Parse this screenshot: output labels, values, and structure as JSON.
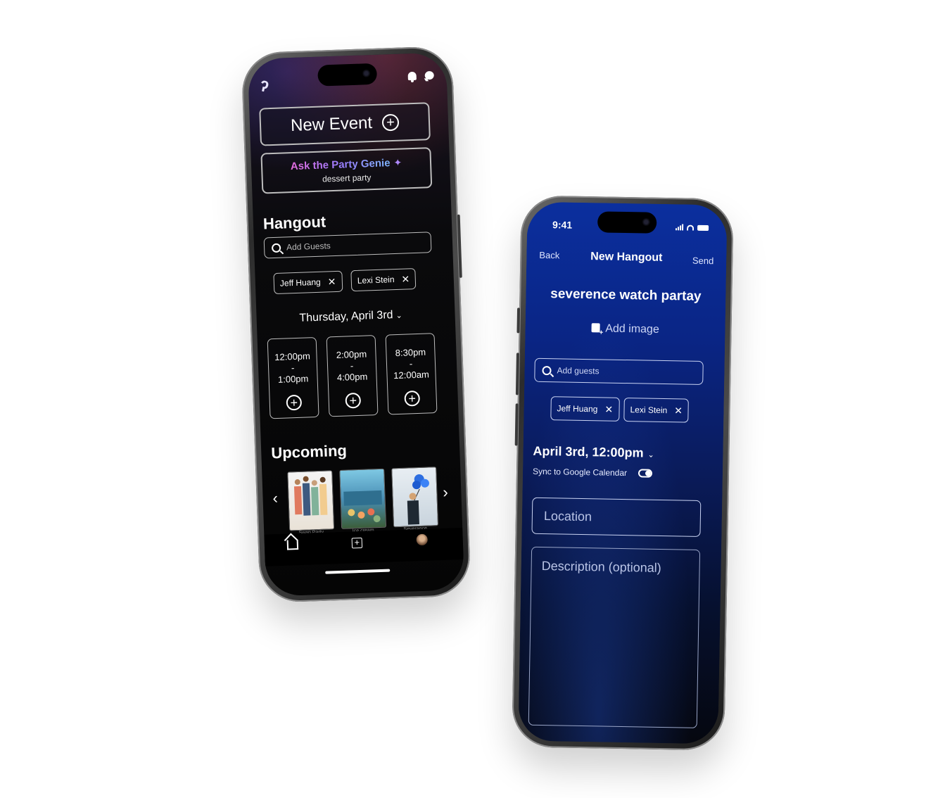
{
  "phone1": {
    "new_event_label": "New Event",
    "genie": {
      "title": "Ask the Party Genie",
      "prompt": "dessert party"
    },
    "hangout_heading": "Hangout",
    "search_placeholder": "Add Guests",
    "guests": [
      "Jeff Huang",
      "Lexi Stein"
    ],
    "date": "Thursday, April 3rd",
    "slots": [
      {
        "start": "12:00pm",
        "sep": "-",
        "end": "1:00pm"
      },
      {
        "start": "2:00pm",
        "sep": "-",
        "end": "4:00pm"
      },
      {
        "start": "8:30pm",
        "sep": "-",
        "end": "12:00am"
      }
    ],
    "upcoming_heading": "Upcoming",
    "upcoming": [
      "Swap Party",
      "Ice cream",
      "Severance"
    ]
  },
  "phone2": {
    "time": "9:41",
    "back": "Back",
    "title": "New Hangout",
    "send": "Send",
    "event_name": "severence watch partay",
    "add_image": "Add image",
    "search_placeholder": "Add guests",
    "guests": [
      "Jeff Huang",
      "Lexi Stein"
    ],
    "datetime": "April 3rd, 12:00pm",
    "sync_label": "Sync to Google Calendar",
    "sync_on": true,
    "location_placeholder": "Location",
    "description_placeholder": "Description (optional)"
  },
  "colors": {
    "phone1_bg": "#050505",
    "phone2_bg": "#0b2f9e",
    "genie_gradient": [
      "#e56ce0",
      "#9a7dff",
      "#7db4ff"
    ]
  },
  "icons": [
    "app-logo-icon",
    "bell-icon",
    "chat-icon",
    "plus-circle-icon",
    "sparkle-icon",
    "search-icon",
    "close-icon",
    "chevron-down-icon",
    "chevron-left-icon",
    "chevron-right-icon",
    "home-icon",
    "add-square-icon",
    "profile-avatar",
    "add-image-icon",
    "signal-icon",
    "wifi-icon",
    "battery-icon",
    "toggle-icon"
  ]
}
